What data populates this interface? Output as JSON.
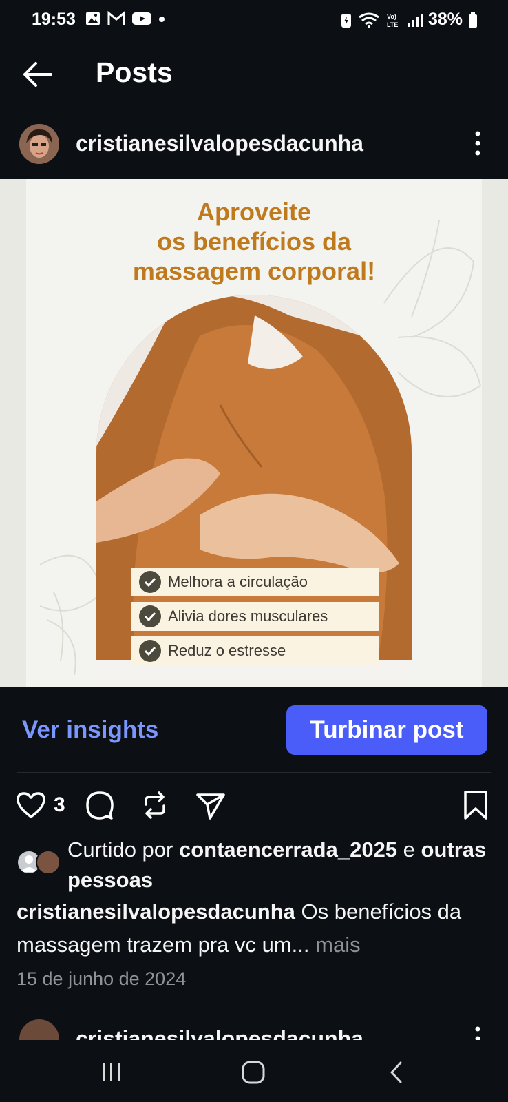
{
  "status_bar": {
    "time": "19:53",
    "battery": "38%",
    "icons": [
      "image-icon",
      "gmail-icon",
      "youtube-icon",
      "dot-icon",
      "battery-saver-icon",
      "wifi-icon",
      "volte-icon",
      "signal-icon",
      "battery-icon"
    ]
  },
  "header": {
    "title": "Posts",
    "back_icon": "arrow-left-icon"
  },
  "post": {
    "username": "cristianesilvalopesdacunha",
    "more_icon": "more-vertical-icon",
    "image": {
      "headline_lines": [
        "Aproveite",
        "os benefícios da",
        "massagem corporal!"
      ],
      "benefits": [
        "Melhora a circulação",
        "Alivia dores musculares",
        "Reduz o estresse"
      ],
      "accent_color": "#c07a1e"
    },
    "insights_label": "Ver insights",
    "boost_label": "Turbinar post",
    "like_count": "3",
    "liked_by_prefix": "Curtido por ",
    "liked_by_user": "contaencerrada_2025",
    "liked_by_connector": " e ",
    "liked_by_others": "outras pessoas",
    "caption_user": "cristianesilvalopesdacunha",
    "caption_text": " Os benefícios da massagem trazem pra vc um... ",
    "caption_more": "mais",
    "date": "15 de junho de 2024"
  },
  "next_post": {
    "username": "cristianesilvalopesdacunha"
  },
  "colors": {
    "background": "#0c1014",
    "primary_button": "#4a5df9",
    "link": "#7b97ff"
  }
}
